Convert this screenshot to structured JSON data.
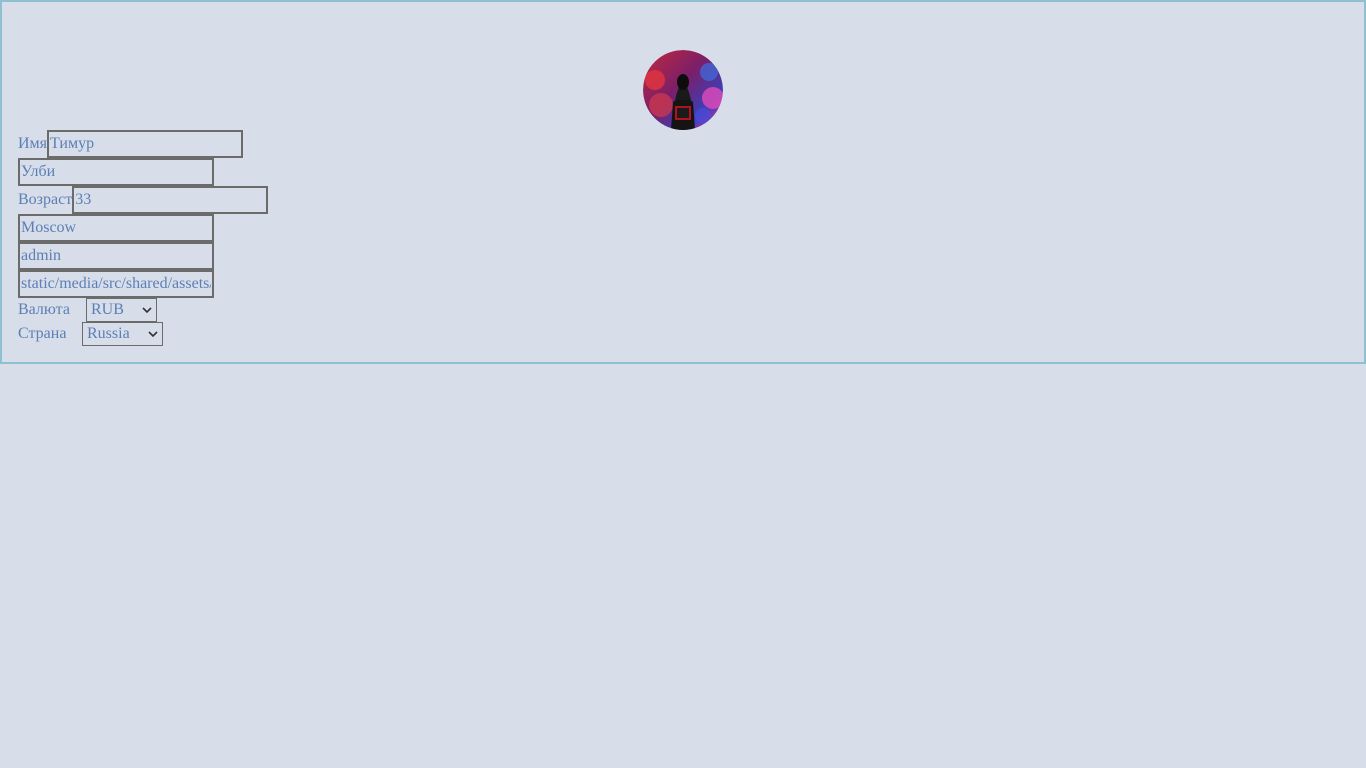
{
  "profile": {
    "avatar_alt": "avatar",
    "first_name": {
      "label": "Имя",
      "value": "Тимур"
    },
    "last_name": {
      "value": "Улби"
    },
    "age": {
      "label": "Возраст",
      "value": "33"
    },
    "city": {
      "value": "Moscow"
    },
    "username": {
      "value": "admin"
    },
    "avatar_path": {
      "value": "static/media/src/shared/assets/"
    },
    "currency": {
      "label": "Валюта",
      "selected": "RUB"
    },
    "country": {
      "label": "Страна",
      "selected": "Russia"
    }
  },
  "colors": {
    "background": "#d8dee9",
    "card_border": "#8fc0cf",
    "text": "#5b7fb5",
    "input_border": "#6b6b6b"
  },
  "icons": {
    "select_arrow": "chevron-down-icon"
  }
}
